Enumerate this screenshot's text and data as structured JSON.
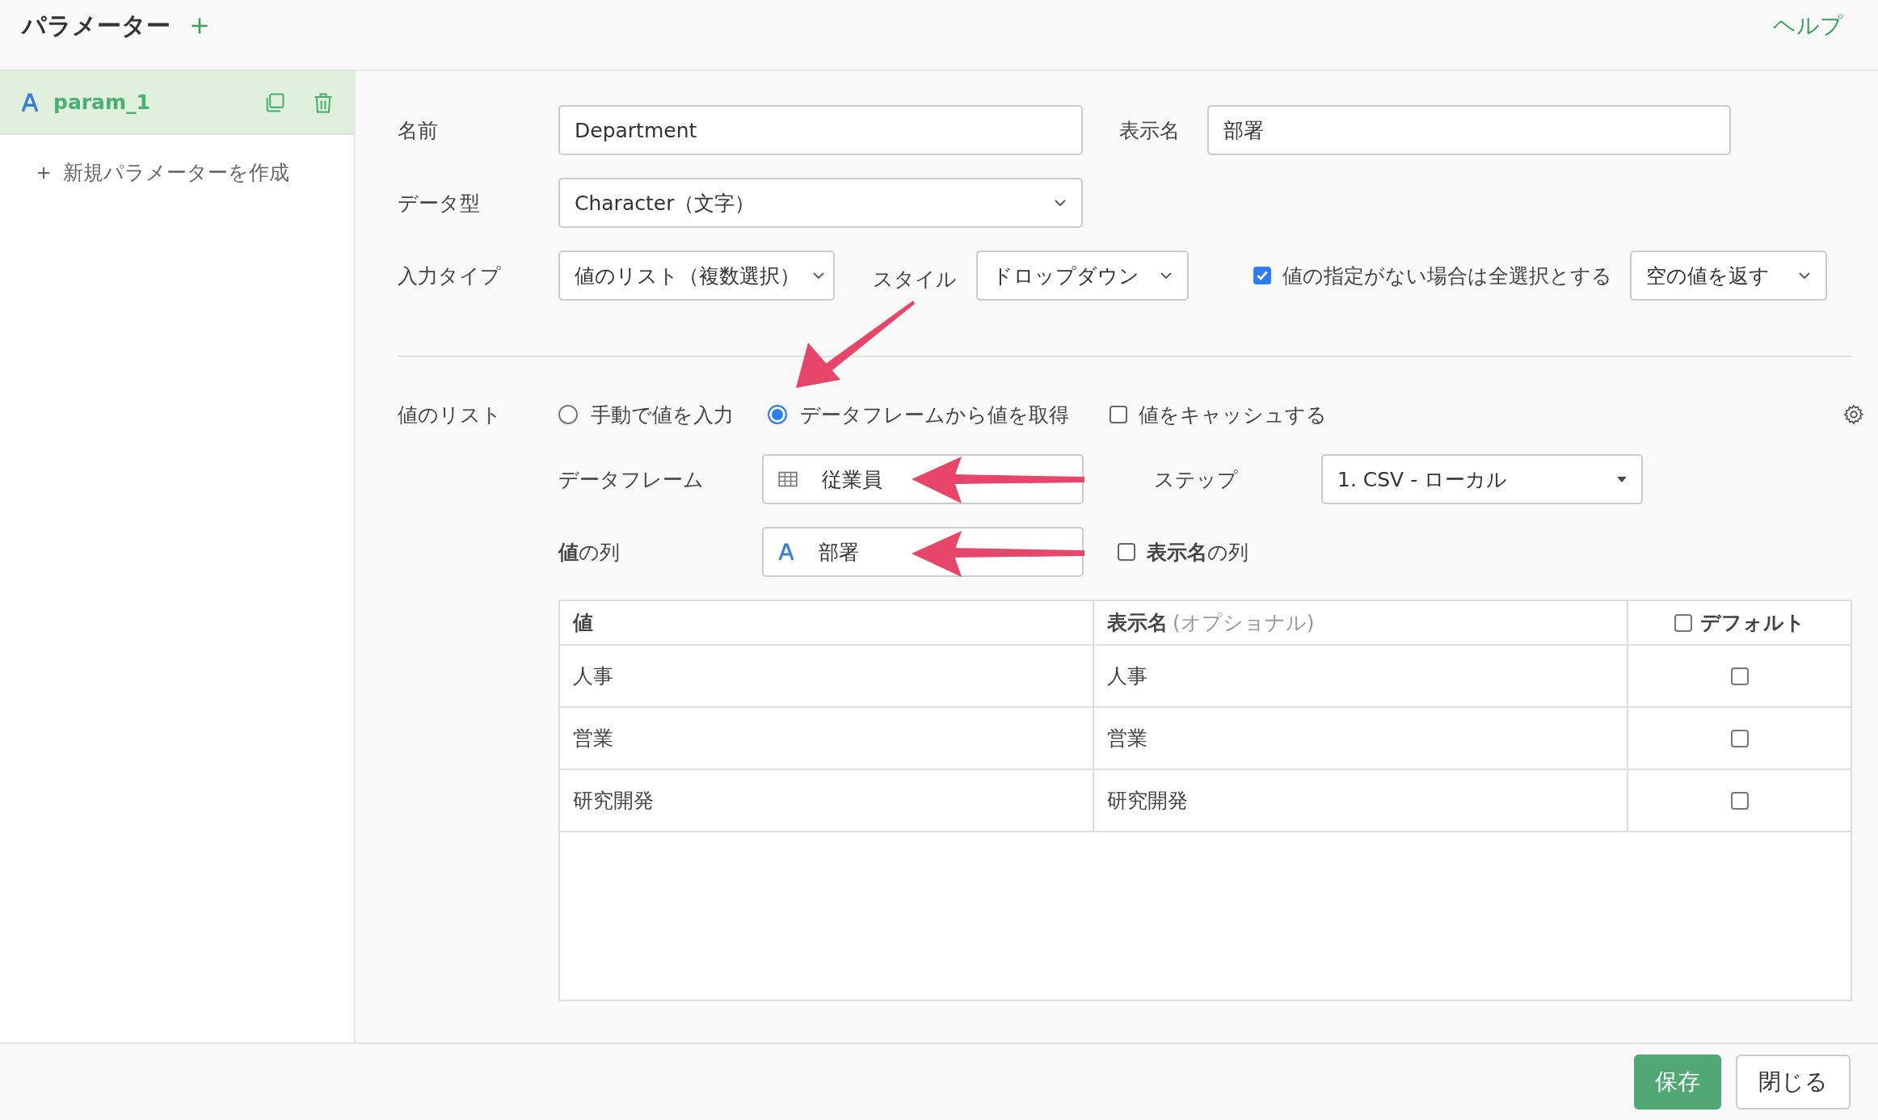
{
  "header": {
    "title": "パラメーター",
    "help": "ヘルプ"
  },
  "sidebar": {
    "items": [
      {
        "name": "param_1",
        "selected": true
      }
    ],
    "new_button": "新規パラメーターを作成"
  },
  "form": {
    "name": {
      "label": "名前",
      "value": "Department"
    },
    "display_name": {
      "label": "表示名",
      "value": "部署"
    },
    "data_type": {
      "label": "データ型",
      "value": "Character（文字）"
    },
    "input_type": {
      "label": "入力タイプ",
      "value": "値のリスト（複数選択）"
    },
    "style": {
      "label": "スタイル",
      "value": "ドロップダウン"
    },
    "select_all": {
      "label": "値の指定がない場合は全選択とする",
      "checked": true
    },
    "empty_option": {
      "value": "空の値を返す"
    }
  },
  "value_list": {
    "label": "値のリスト",
    "sources": [
      {
        "label": "手動で値を入力",
        "selected": false
      },
      {
        "label": "データフレームから値を取得",
        "selected": true
      }
    ],
    "cache": {
      "label": "値をキャッシュする",
      "checked": false
    },
    "dataframe": {
      "label": "データフレーム",
      "value": "従業員"
    },
    "step": {
      "label": "ステップ",
      "value": "1. CSV - ローカル"
    },
    "value_column": {
      "label": "**値**の列",
      "value": "部署"
    },
    "display_column": {
      "label": "**表示名**の列",
      "checked": false
    }
  },
  "table": {
    "columns": [
      {
        "label": "値"
      },
      {
        "label": "表示名",
        "note": "(オプショナル)"
      },
      {
        "label": "デフォルト",
        "checked": false
      }
    ],
    "rows": [
      {
        "value": "人事",
        "display": "人事",
        "default": false
      },
      {
        "value": "営業",
        "display": "営業",
        "default": false
      },
      {
        "value": "研究開発",
        "display": "研究開発",
        "default": false
      }
    ]
  },
  "footer": {
    "buttons": [
      {
        "label": "保存",
        "kind": "primary"
      },
      {
        "label": "閉じる",
        "kind": "default"
      }
    ]
  }
}
